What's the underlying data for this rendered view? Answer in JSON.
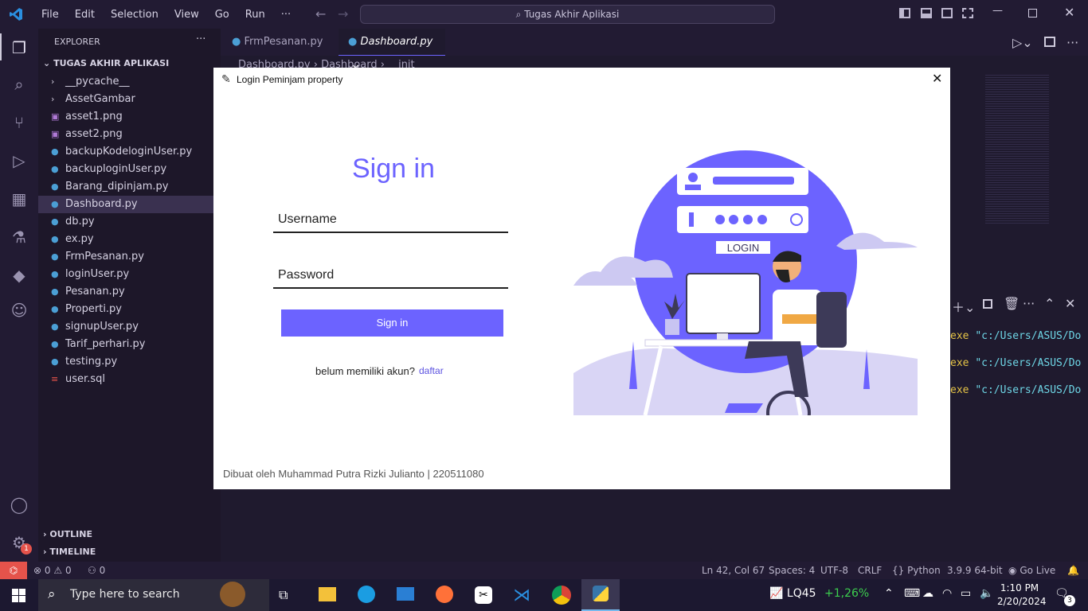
{
  "titlebar": {
    "menu": [
      "File",
      "Edit",
      "Selection",
      "View",
      "Go",
      "Run",
      "···"
    ],
    "search": "Tugas Akhir Aplikasi"
  },
  "sidebar": {
    "header": "EXPLORER",
    "project": "TUGAS AKHIR APLIKASI",
    "items": [
      {
        "label": "__pycache__",
        "kind": "folder"
      },
      {
        "label": "AssetGambar",
        "kind": "folder"
      },
      {
        "label": "asset1.png",
        "kind": "image"
      },
      {
        "label": "asset2.png",
        "kind": "image"
      },
      {
        "label": "backupKodeloginUser.py",
        "kind": "python"
      },
      {
        "label": "backuploginUser.py",
        "kind": "python"
      },
      {
        "label": "Barang_dipinjam.py",
        "kind": "python"
      },
      {
        "label": "Dashboard.py",
        "kind": "python"
      },
      {
        "label": "db.py",
        "kind": "python"
      },
      {
        "label": "ex.py",
        "kind": "python"
      },
      {
        "label": "FrmPesanan.py",
        "kind": "python"
      },
      {
        "label": "loginUser.py",
        "kind": "python"
      },
      {
        "label": "Pesanan.py",
        "kind": "python"
      },
      {
        "label": "Properti.py",
        "kind": "python"
      },
      {
        "label": "signupUser.py",
        "kind": "python"
      },
      {
        "label": "Tarif_perhari.py",
        "kind": "python"
      },
      {
        "label": "testing.py",
        "kind": "python"
      },
      {
        "label": "user.sql",
        "kind": "database"
      }
    ],
    "outline": "OUTLINE",
    "timeline": "TIMELINE"
  },
  "editor": {
    "tabs": [
      "FrmPesanan.py",
      "Dashboard.py"
    ],
    "breadcrumb": [
      "Dashboard.py",
      "Dashboard",
      "__init__"
    ],
    "terminal_lines": [
      {
        "prefix": "exe ",
        "path": "\"c:/Users/ASUS/Do"
      },
      {
        "prefix": "exe ",
        "path": "\"c:/Users/ASUS/Do"
      },
      {
        "prefix": "exe ",
        "path": "\"c:/Users/ASUS/Do"
      }
    ]
  },
  "dialog": {
    "title": "Login Peminjam property",
    "heading": "Sign in",
    "username_placeholder": "Username",
    "password_placeholder": "Password",
    "signin_button": "Sign in",
    "no_account": "belum memiliki akun?",
    "register_link": "daftar",
    "footer": "Dibuat oleh Muhammad Putra Rizki Julianto | 220511080",
    "illustration_label": "LOGIN",
    "accent": "#6c63ff"
  },
  "status": {
    "errors": "0",
    "warnings": "0",
    "ports": "0",
    "position": "Ln 42, Col 67",
    "spaces": "Spaces: 4",
    "encoding": "UTF-8",
    "eol": "CRLF",
    "language": "Python",
    "interpreter": "3.9.9 64-bit",
    "live": "Go Live",
    "gear_badge": "1"
  },
  "taskbar": {
    "search": "Type here to search",
    "stock_name": "LQ45",
    "stock_change": "+1,26%",
    "time": "1:10 PM",
    "date": "2/20/2024",
    "notifications": "3"
  }
}
